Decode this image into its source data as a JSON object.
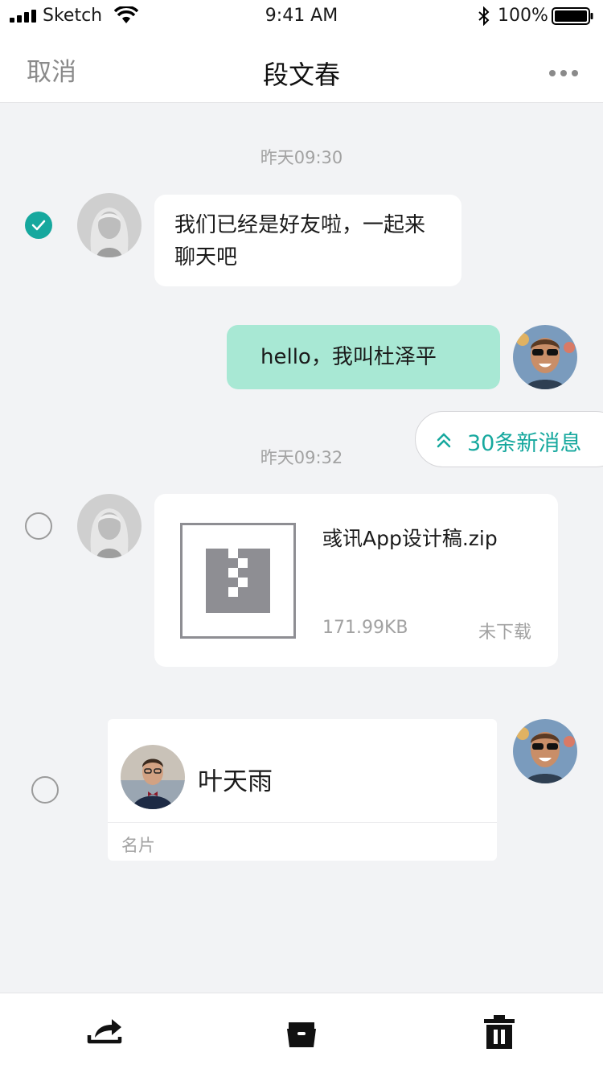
{
  "status_bar": {
    "carrier": "Sketch",
    "time": "9:41 AM",
    "battery": "100%"
  },
  "nav": {
    "cancel": "取消",
    "title": "段文春"
  },
  "messages": {
    "timestamp_1": "昨天09:30",
    "incoming_text": "我们已经是好友啦，一起来聊天吧",
    "outgoing_text": "hello，我叫杜泽平",
    "timestamp_2": "昨天09:32",
    "new_messages": "30条新消息",
    "file": {
      "name": "彧讯App设计稿.zip",
      "size": "171.99KB",
      "status": "未下载"
    },
    "contact_card": {
      "name": "叶天雨",
      "label": "名片"
    }
  },
  "colors": {
    "accent": "#16a89e",
    "outgoing_bubble": "#a8e8d4",
    "background": "#f2f3f5"
  },
  "toolbar": {
    "icons": [
      "share-icon",
      "favorite-icon",
      "trash-icon"
    ]
  }
}
